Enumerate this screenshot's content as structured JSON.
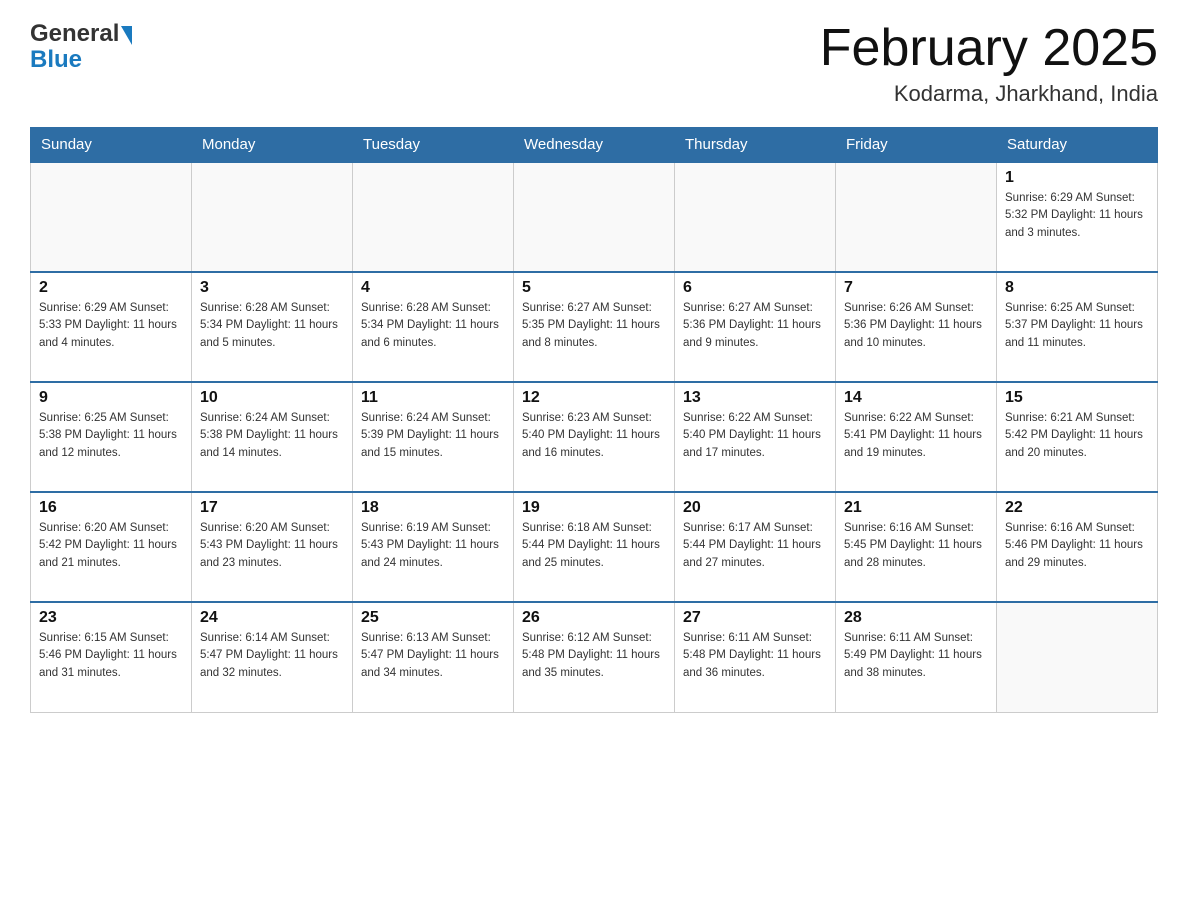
{
  "header": {
    "logo": {
      "general": "General",
      "blue": "Blue"
    },
    "title": "February 2025",
    "location": "Kodarma, Jharkhand, India"
  },
  "calendar": {
    "days_of_week": [
      "Sunday",
      "Monday",
      "Tuesday",
      "Wednesday",
      "Thursday",
      "Friday",
      "Saturday"
    ],
    "weeks": [
      [
        {
          "day": "",
          "info": ""
        },
        {
          "day": "",
          "info": ""
        },
        {
          "day": "",
          "info": ""
        },
        {
          "day": "",
          "info": ""
        },
        {
          "day": "",
          "info": ""
        },
        {
          "day": "",
          "info": ""
        },
        {
          "day": "1",
          "info": "Sunrise: 6:29 AM\nSunset: 5:32 PM\nDaylight: 11 hours and 3 minutes."
        }
      ],
      [
        {
          "day": "2",
          "info": "Sunrise: 6:29 AM\nSunset: 5:33 PM\nDaylight: 11 hours and 4 minutes."
        },
        {
          "day": "3",
          "info": "Sunrise: 6:28 AM\nSunset: 5:34 PM\nDaylight: 11 hours and 5 minutes."
        },
        {
          "day": "4",
          "info": "Sunrise: 6:28 AM\nSunset: 5:34 PM\nDaylight: 11 hours and 6 minutes."
        },
        {
          "day": "5",
          "info": "Sunrise: 6:27 AM\nSunset: 5:35 PM\nDaylight: 11 hours and 8 minutes."
        },
        {
          "day": "6",
          "info": "Sunrise: 6:27 AM\nSunset: 5:36 PM\nDaylight: 11 hours and 9 minutes."
        },
        {
          "day": "7",
          "info": "Sunrise: 6:26 AM\nSunset: 5:36 PM\nDaylight: 11 hours and 10 minutes."
        },
        {
          "day": "8",
          "info": "Sunrise: 6:25 AM\nSunset: 5:37 PM\nDaylight: 11 hours and 11 minutes."
        }
      ],
      [
        {
          "day": "9",
          "info": "Sunrise: 6:25 AM\nSunset: 5:38 PM\nDaylight: 11 hours and 12 minutes."
        },
        {
          "day": "10",
          "info": "Sunrise: 6:24 AM\nSunset: 5:38 PM\nDaylight: 11 hours and 14 minutes."
        },
        {
          "day": "11",
          "info": "Sunrise: 6:24 AM\nSunset: 5:39 PM\nDaylight: 11 hours and 15 minutes."
        },
        {
          "day": "12",
          "info": "Sunrise: 6:23 AM\nSunset: 5:40 PM\nDaylight: 11 hours and 16 minutes."
        },
        {
          "day": "13",
          "info": "Sunrise: 6:22 AM\nSunset: 5:40 PM\nDaylight: 11 hours and 17 minutes."
        },
        {
          "day": "14",
          "info": "Sunrise: 6:22 AM\nSunset: 5:41 PM\nDaylight: 11 hours and 19 minutes."
        },
        {
          "day": "15",
          "info": "Sunrise: 6:21 AM\nSunset: 5:42 PM\nDaylight: 11 hours and 20 minutes."
        }
      ],
      [
        {
          "day": "16",
          "info": "Sunrise: 6:20 AM\nSunset: 5:42 PM\nDaylight: 11 hours and 21 minutes."
        },
        {
          "day": "17",
          "info": "Sunrise: 6:20 AM\nSunset: 5:43 PM\nDaylight: 11 hours and 23 minutes."
        },
        {
          "day": "18",
          "info": "Sunrise: 6:19 AM\nSunset: 5:43 PM\nDaylight: 11 hours and 24 minutes."
        },
        {
          "day": "19",
          "info": "Sunrise: 6:18 AM\nSunset: 5:44 PM\nDaylight: 11 hours and 25 minutes."
        },
        {
          "day": "20",
          "info": "Sunrise: 6:17 AM\nSunset: 5:44 PM\nDaylight: 11 hours and 27 minutes."
        },
        {
          "day": "21",
          "info": "Sunrise: 6:16 AM\nSunset: 5:45 PM\nDaylight: 11 hours and 28 minutes."
        },
        {
          "day": "22",
          "info": "Sunrise: 6:16 AM\nSunset: 5:46 PM\nDaylight: 11 hours and 29 minutes."
        }
      ],
      [
        {
          "day": "23",
          "info": "Sunrise: 6:15 AM\nSunset: 5:46 PM\nDaylight: 11 hours and 31 minutes."
        },
        {
          "day": "24",
          "info": "Sunrise: 6:14 AM\nSunset: 5:47 PM\nDaylight: 11 hours and 32 minutes."
        },
        {
          "day": "25",
          "info": "Sunrise: 6:13 AM\nSunset: 5:47 PM\nDaylight: 11 hours and 34 minutes."
        },
        {
          "day": "26",
          "info": "Sunrise: 6:12 AM\nSunset: 5:48 PM\nDaylight: 11 hours and 35 minutes."
        },
        {
          "day": "27",
          "info": "Sunrise: 6:11 AM\nSunset: 5:48 PM\nDaylight: 11 hours and 36 minutes."
        },
        {
          "day": "28",
          "info": "Sunrise: 6:11 AM\nSunset: 5:49 PM\nDaylight: 11 hours and 38 minutes."
        },
        {
          "day": "",
          "info": ""
        }
      ]
    ]
  }
}
